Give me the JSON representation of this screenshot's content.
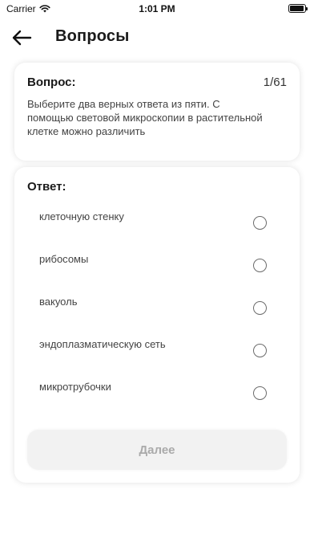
{
  "status_bar": {
    "carrier": "Carrier",
    "time": "1:01 PM",
    "battery_level": 0.95
  },
  "header": {
    "title": "Вопросы",
    "back_icon": "arrow-left-icon"
  },
  "question": {
    "label": "Вопрос:",
    "counter": "1/61",
    "text": "Выберите два верных ответа из пяти. С помощью световой микроскопии в растительной клетке можно различить"
  },
  "answer": {
    "label": "Ответ:",
    "options": [
      {
        "text": "клеточную стенку",
        "selected": false
      },
      {
        "text": "рибосомы",
        "selected": false
      },
      {
        "text": "вакуоль",
        "selected": false
      },
      {
        "text": "эндоплазматическую сеть",
        "selected": false
      },
      {
        "text": "микротрубочки",
        "selected": false
      }
    ],
    "next_label": "Далее"
  }
}
